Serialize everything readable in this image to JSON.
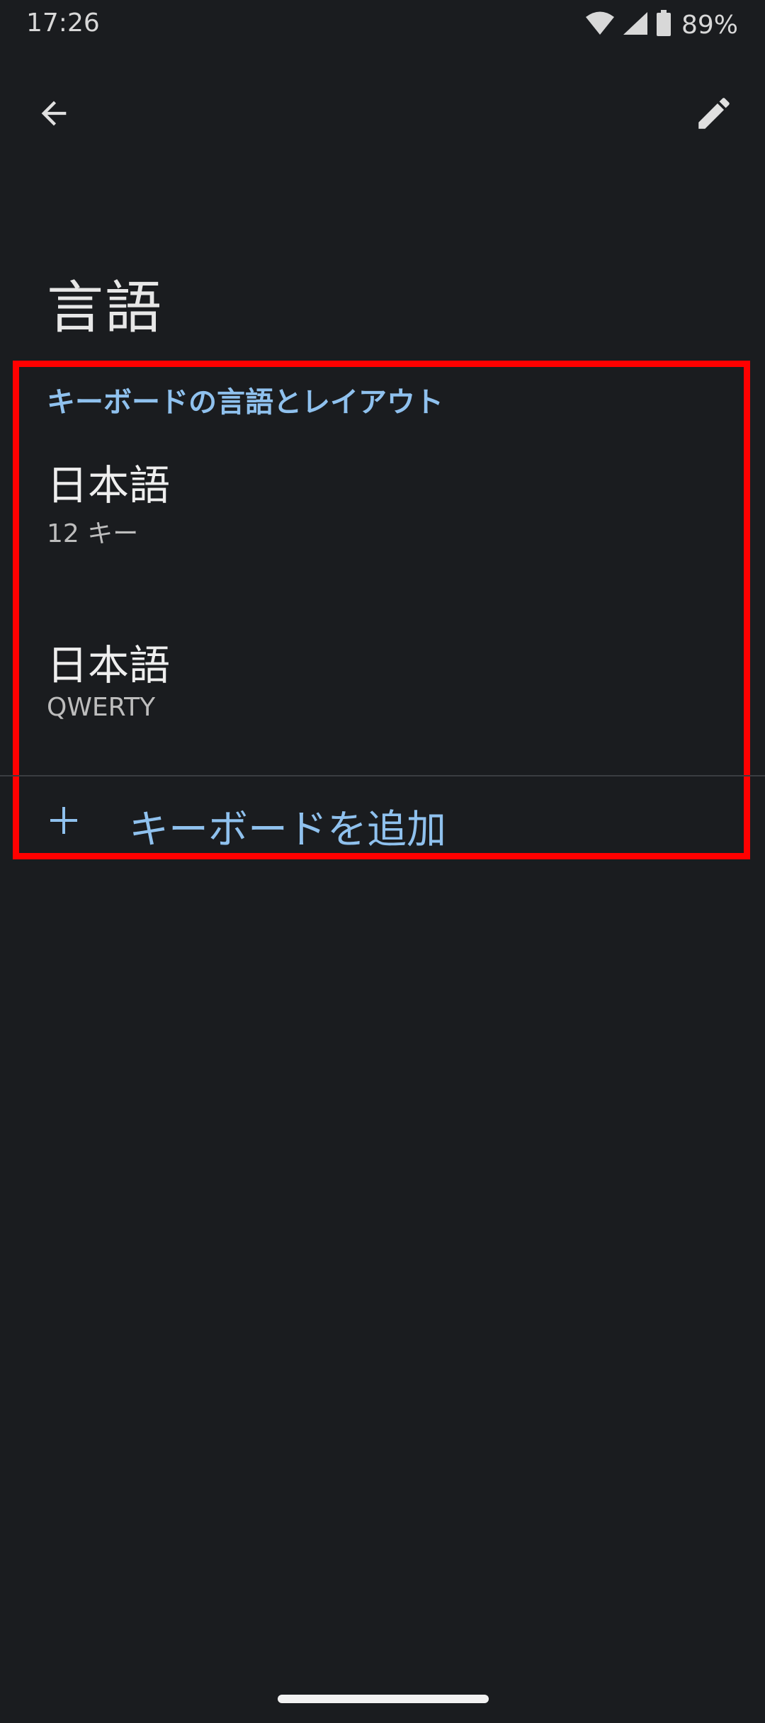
{
  "status_bar": {
    "time": "17:26",
    "battery": "89%",
    "icons": [
      "wifi-icon",
      "signal-icon",
      "battery-icon"
    ]
  },
  "app_bar": {
    "back_icon": "arrow-back-icon",
    "edit_icon": "pencil-icon"
  },
  "page": {
    "title": "言語"
  },
  "section": {
    "header": "キーボードの言語とレイアウト",
    "items": [
      {
        "title": "日本語",
        "subtitle": "12 キー"
      },
      {
        "title": "日本語",
        "subtitle": "QWERTY"
      }
    ],
    "add_label": "キーボードを追加",
    "add_icon": "plus-icon"
  },
  "colors": {
    "background": "#1a1c1f",
    "accent": "#8fc1ee",
    "highlight": "#ff0000"
  }
}
